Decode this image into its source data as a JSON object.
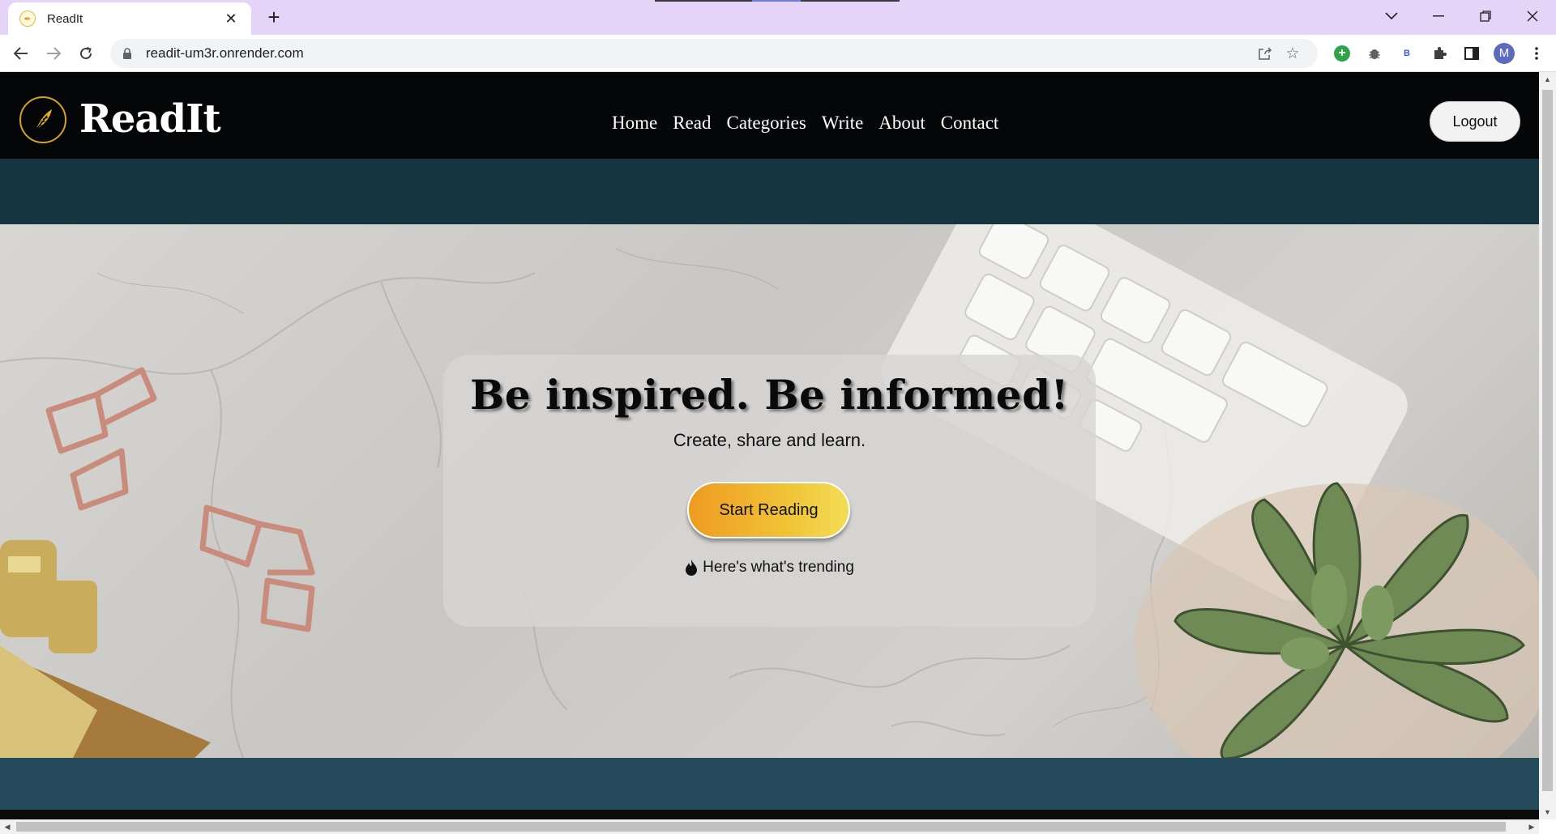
{
  "browser": {
    "tab_title": "ReadIt",
    "tab_close": "✕",
    "new_tab": "+",
    "url": "readit-um3r.onrender.com",
    "window_controls": [
      "chevron-down",
      "minimize",
      "restore",
      "close"
    ],
    "profile_initial": "M",
    "extension_b_label": "B"
  },
  "site": {
    "logo_text": "ReadIt",
    "nav": [
      "Home",
      "Read",
      "Categories",
      "Write",
      "About",
      "Contact"
    ],
    "logout_label": "Logout"
  },
  "hero": {
    "title": "Be inspired. Be informed!",
    "subtitle": "Create, share and learn.",
    "cta_label": "Start Reading",
    "trending_label": "Here's what's trending"
  },
  "colors": {
    "header_bg": "#040608",
    "band_bg": "#153540",
    "lower_band_bg": "#244a5c",
    "cta_gradient_start": "#ee9b22",
    "cta_gradient_end": "#f2dd55",
    "logo_gold": "#d6a21e",
    "tabbar_bg": "#e6d3f8"
  }
}
